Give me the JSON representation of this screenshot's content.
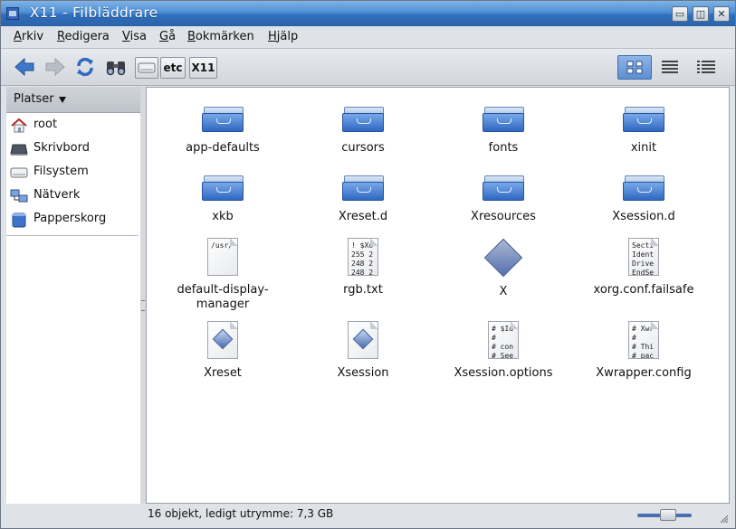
{
  "window": {
    "title": "X11 - Filbläddrare"
  },
  "menu": [
    "Arkiv",
    "Redigera",
    "Visa",
    "Gå",
    "Bokmärken",
    "Hjälp"
  ],
  "breadcrumbs": [
    "etc",
    "X11"
  ],
  "sidebar": {
    "header": "Platser",
    "items": [
      {
        "label": "root",
        "icon": "home-icon"
      },
      {
        "label": "Skrivbord",
        "icon": "desktop-icon"
      },
      {
        "label": "Filsystem",
        "icon": "drive-icon"
      },
      {
        "label": "Nätverk",
        "icon": "network-icon"
      },
      {
        "label": "Papperskorg",
        "icon": "trash-icon"
      }
    ]
  },
  "files": [
    {
      "name": "app-defaults",
      "type": "folder"
    },
    {
      "name": "cursors",
      "type": "folder"
    },
    {
      "name": "fonts",
      "type": "folder"
    },
    {
      "name": "xinit",
      "type": "folder"
    },
    {
      "name": "xkb",
      "type": "folder"
    },
    {
      "name": "Xreset.d",
      "type": "folder"
    },
    {
      "name": "Xresources",
      "type": "folder"
    },
    {
      "name": "Xsession.d",
      "type": "folder"
    },
    {
      "name": "default-display-manager",
      "type": "text",
      "preview": "/usr/"
    },
    {
      "name": "rgb.txt",
      "type": "text",
      "preview": "! $Xo\n255 2\n248 2\n248 2"
    },
    {
      "name": "X",
      "type": "executable"
    },
    {
      "name": "xorg.conf.failsafe",
      "type": "text",
      "preview": "Secti\nIdent\nDrive\nEndSe"
    },
    {
      "name": "Xreset",
      "type": "script"
    },
    {
      "name": "Xsession",
      "type": "script"
    },
    {
      "name": "Xsession.options",
      "type": "text",
      "preview": "# $Id\n#\n# con\n# See"
    },
    {
      "name": "Xwrapper.config",
      "type": "text",
      "preview": "# Xwr\n#\n# Thi\n# pac"
    }
  ],
  "status": {
    "text": "16 objekt, ledigt utrymme: 7,3 GB"
  },
  "colors": {
    "titlebar": "#2f6fbd",
    "folder": "#3a74c8"
  }
}
